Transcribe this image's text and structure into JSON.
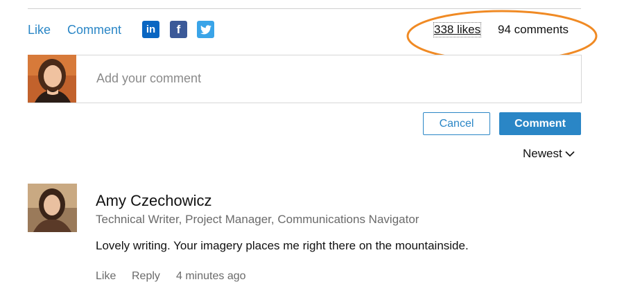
{
  "actions": {
    "like_label": "Like",
    "comment_label": "Comment"
  },
  "share_icons": [
    "linkedin-icon",
    "facebook-icon",
    "twitter-icon"
  ],
  "share_glyphs": {
    "linkedin": "in",
    "facebook": "f"
  },
  "stats": {
    "likes": "338 likes",
    "comments": "94 comments"
  },
  "composer": {
    "placeholder": "Add your comment",
    "cancel_label": "Cancel",
    "submit_label": "Comment"
  },
  "sort": {
    "selected": "Newest"
  },
  "comment": {
    "author": "Amy Czechowicz",
    "headline": "Technical Writer, Project Manager, Communications Navigator",
    "body": "Lovely writing. Your imagery places me right there on the mountainside.",
    "like_label": "Like",
    "reply_label": "Reply",
    "timestamp": "4 minutes ago"
  },
  "colors": {
    "accent": "#2a86c6",
    "highlight": "#f08a24",
    "linkedin": "#0a66c2",
    "facebook": "#3b5998",
    "twitter": "#3aa4e8"
  }
}
